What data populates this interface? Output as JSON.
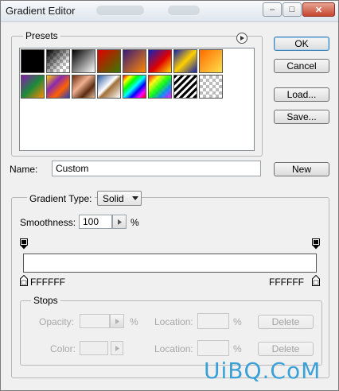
{
  "window": {
    "title": "Gradient Editor",
    "controls": {
      "minimize": "–",
      "maximize": "□",
      "close": "✕"
    }
  },
  "buttons": {
    "ok": "OK",
    "cancel": "Cancel",
    "load": "Load...",
    "save": "Save...",
    "new": "New"
  },
  "presets": {
    "label": "Presets",
    "menu_icon": "play-circle-icon",
    "swatches": [
      "black",
      "transparent-checker",
      "black-white",
      "red-green",
      "violet-orange",
      "blue-red-yellow",
      "blue-yellow-blue",
      "orange-yellow",
      "violet-green-orange",
      "yellow-violet-orange-blue",
      "copper",
      "chrome",
      "spectrum",
      "transparent-rainbow",
      "transparent-stripes",
      "neutral-checker"
    ]
  },
  "name": {
    "label": "Name:",
    "value": "Custom"
  },
  "gradient_type": {
    "label": "Gradient Type:",
    "value": "Solid"
  },
  "smoothness": {
    "label": "Smoothness:",
    "value": "100",
    "unit": "%"
  },
  "stops_top": {
    "left_color": "#000000",
    "right_color": "#000000"
  },
  "stops_bottom": {
    "left_hex": "FFFFFF",
    "right_hex": "FFFFFF"
  },
  "stops_group": {
    "label": "Stops",
    "opacity": {
      "label": "Opacity:",
      "unit": "%"
    },
    "opacity_location": {
      "label": "Location:",
      "unit": "%"
    },
    "color": {
      "label": "Color:"
    },
    "color_location": {
      "label": "Location:",
      "unit": "%"
    },
    "delete_label": "Delete"
  },
  "watermark": "UiBQ.CoM",
  "colors": {
    "accent": "#3c7fb1",
    "watermark": "#3aa0d8"
  }
}
